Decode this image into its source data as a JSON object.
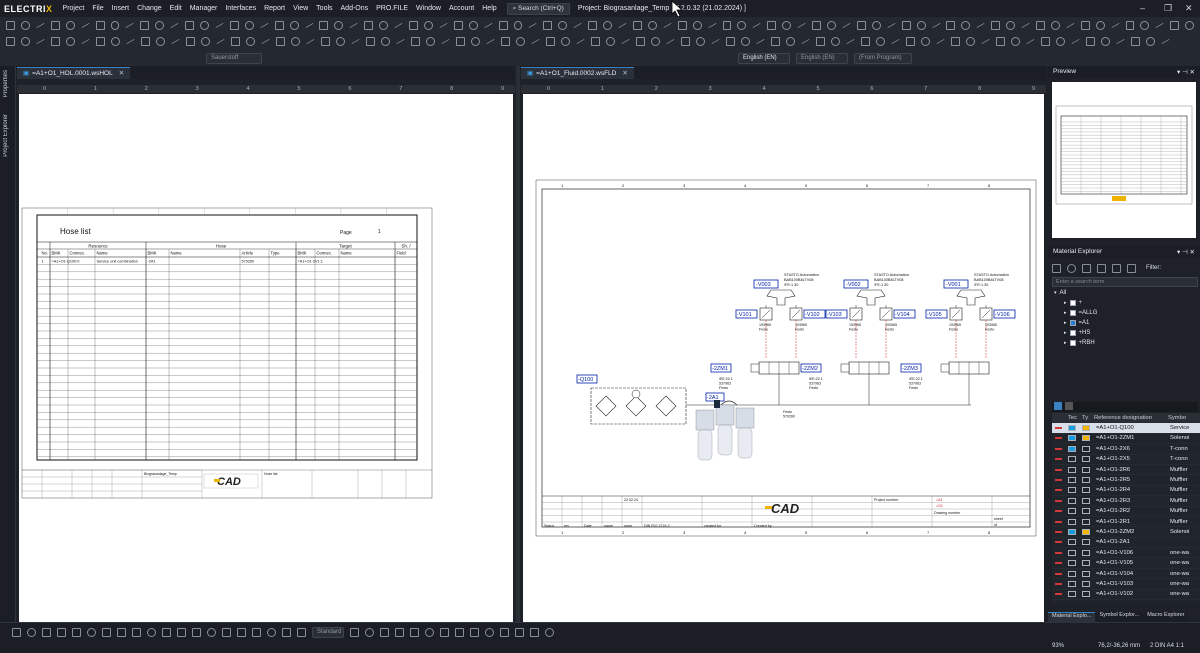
{
  "app": {
    "logo_a": "ELECTRI",
    "logo_b": "X",
    "project_title": "Project: Biograsanlage_Temp  [ 7.2.0.32 (21.02.2024) ]",
    "search": "Search (Ctrl+Q)"
  },
  "menu": [
    "Project",
    "File",
    "Insert",
    "Change",
    "Edit",
    "Manager",
    "Interfaces",
    "Report",
    "View",
    "Tools",
    "Add-Ons",
    "PRO.FILE",
    "Window",
    "Account",
    "Help"
  ],
  "toolbar": {
    "dd_sauerstoff": "Sauerstoff",
    "dd_lang1": "English (EN)",
    "dd_lang2": "English (EN)",
    "dd_program": "(From Program)",
    "dd_standard": "Standard"
  },
  "leftstrip": {
    "properties": "Properties",
    "project_explorer": "Project Explorer"
  },
  "doc1": {
    "tab": "=A1+O1_HOL.0001.wsHOL",
    "ruler": [
      "0",
      "1",
      "2",
      "3",
      "4",
      "5",
      "6",
      "7",
      "8",
      "9"
    ],
    "title": "Hose list",
    "page_label": "Page",
    "page_no": "1",
    "groups": [
      "Resource",
      "Hose",
      "Target",
      "Sh. /"
    ],
    "cols": [
      "No.",
      "BMK",
      "Connec.",
      "Name",
      "BMK",
      "Name",
      "Article",
      "Type",
      "BMK",
      "Connec.",
      "Name",
      "Field"
    ],
    "row1": [
      "1",
      "=A1+O1-Q100:0",
      "",
      "Service unit combination",
      "-2A1",
      "",
      "570260",
      "",
      "=A1+O1-2V1:1",
      "",
      "",
      ""
    ],
    "footer_drawing": "Biograsanlage_Temp",
    "footer_title": "Hose list"
  },
  "doc2": {
    "tab": "=A1+O1_Fluid.0002.wsFLD",
    "ruler": [
      "0",
      "1",
      "2",
      "3",
      "4",
      "5",
      "6",
      "7",
      "8",
      "9"
    ],
    "frame_cols": [
      "1",
      "2",
      "3",
      "4",
      "5",
      "6",
      "7",
      "8"
    ],
    "v_labels": [
      "-V003",
      "-V002",
      "-V001"
    ],
    "valve_text": [
      "STASTO Automation",
      "BAB100B8LTV08",
      "/FE:1.30"
    ],
    "throttles": [
      "-V101",
      "-V102",
      "-V103",
      "-V104",
      "-V105",
      "-V106"
    ],
    "thr_text": [
      "193965",
      "Festo"
    ],
    "cyl": [
      "-2ZM1",
      "-2ZM2",
      "-2ZM3"
    ],
    "cyl_text": [
      "/EE:22.1",
      "537963",
      "Festo"
    ],
    "unit": "-Q100",
    "hose": "-2A1",
    "hose_text": [
      "Festo",
      "570260"
    ],
    "footer": {
      "date": "22.02.24",
      "status": "Status",
      "rev": "rev",
      "date_l": "Date",
      "name": "name",
      "norm": "norm",
      "din": "DIN ISO 1219-2",
      "created": "created for",
      "createdby": "Created by",
      "project_number": "Project number",
      "drawing_number": "Drawing number",
      "sheet": "sheet",
      "of": "of",
      "ident": "=A1",
      "field": "=O1"
    }
  },
  "preview": {
    "title": "Preview"
  },
  "material": {
    "title": "Material Explorer",
    "filter_label": "Filter:",
    "search_placeholder": "Enter a search term",
    "tree": [
      {
        "label": "All",
        "cb": false
      },
      {
        "label": "+",
        "cb": true
      },
      {
        "label": "=ALLG",
        "cb": true
      },
      {
        "label": "=A1",
        "cb": true
      },
      {
        "label": "+HS",
        "cb": true
      },
      {
        "label": "+RBH",
        "cb": true
      }
    ],
    "headers": [
      "Tec",
      "Ty",
      "Reference designation",
      "Symbo"
    ],
    "rows": [
      {
        "ref": "=A1+O1-Q100",
        "type": "Service",
        "sel": true
      },
      {
        "ref": "=A1+O1-2ZM1",
        "type": "Solenoi"
      },
      {
        "ref": "=A1+O1-2X6",
        "type": "T-conn"
      },
      {
        "ref": "=A1+O1-2X5",
        "type": "T-conn"
      },
      {
        "ref": "=A1+O1-2R6",
        "type": "Muffler"
      },
      {
        "ref": "=A1+O1-2R5",
        "type": "Muffler"
      },
      {
        "ref": "=A1+O1-2R4",
        "type": "Muffler"
      },
      {
        "ref": "=A1+O1-2R3",
        "type": "Muffler"
      },
      {
        "ref": "=A1+O1-2R2",
        "type": "Muffler"
      },
      {
        "ref": "=A1+O1-2R1",
        "type": "Muffler"
      },
      {
        "ref": "=A1+O1-2ZM2",
        "type": "Solenoi"
      },
      {
        "ref": "=A1+O1-2A1",
        "type": ""
      },
      {
        "ref": "=A1+O1-V106",
        "type": "one-wa"
      },
      {
        "ref": "=A1+O1-V105",
        "type": "one-wa"
      },
      {
        "ref": "=A1+O1-V104",
        "type": "one-wa"
      },
      {
        "ref": "=A1+O1-V103",
        "type": "one-wa"
      },
      {
        "ref": "=A1+O1-V102",
        "type": "one-wa"
      }
    ],
    "bottom_tabs": [
      "Material Explo...",
      "Symbol Explor...",
      "Macro Explorer"
    ]
  },
  "status": {
    "zoom": "93%",
    "coords": "76,2/-36,26 mm",
    "format": "2  DIN A4  1:1"
  }
}
